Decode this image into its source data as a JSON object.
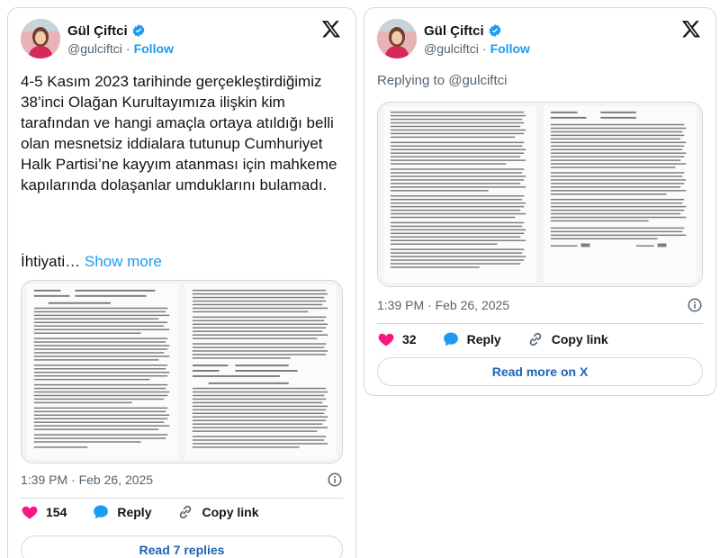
{
  "colors": {
    "accent": "#1d9bf0",
    "like": "#f91880",
    "text": "#0f1419",
    "muted": "#536471",
    "border": "#cfd9de"
  },
  "left_tweet": {
    "author_name": "Gül Çiftci",
    "author_handle": "@gulciftci",
    "separator": "·",
    "follow_label": "Follow",
    "body": "4-5 Kasım 2023 tarihinde gerçekleştirdiğimiz 38’inci Olağan Kurultayımıza ilişkin kim tarafından ve hangi amaçla ortaya atıldığı belli olan mesnetsiz iddialara tutunup Cumhuriyet Halk Partisi’ne kayyım atanması için mahkeme kapılarında dolaşanlar umduklarını bulamadı.",
    "truncated_text": "İhtiyati…",
    "show_more_label": "Show more",
    "timestamp": "1:39 PM · Feb 26, 2025",
    "like_count": "154",
    "reply_label": "Reply",
    "copy_link_label": "Copy link",
    "footer_button": "Read 7 replies",
    "icons": [
      "verified-badge-icon",
      "x-logo-icon",
      "info-icon",
      "heart-icon",
      "reply-icon",
      "link-icon"
    ]
  },
  "right_tweet": {
    "author_name": "Gül Çiftci",
    "author_handle": "@gulciftci",
    "separator": "·",
    "follow_label": "Follow",
    "replying_to": "Replying to @gulciftci",
    "timestamp": "1:39 PM · Feb 26, 2025",
    "like_count": "32",
    "reply_label": "Reply",
    "copy_link_label": "Copy link",
    "footer_button": "Read more on X",
    "icons": [
      "verified-badge-icon",
      "x-logo-icon",
      "info-icon",
      "heart-icon",
      "reply-icon",
      "link-icon"
    ]
  }
}
